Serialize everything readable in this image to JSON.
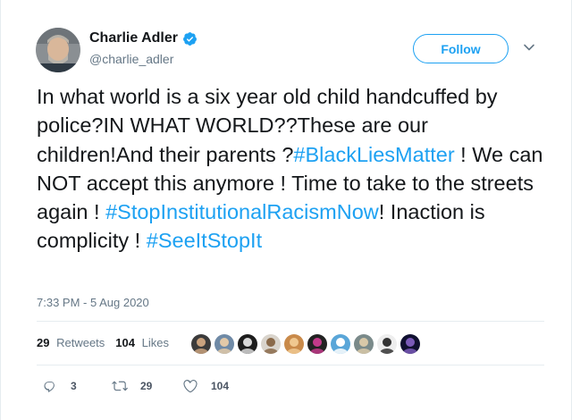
{
  "author": {
    "display_name": "Charlie Adler",
    "handle": "@charlie_adler",
    "verified": true
  },
  "follow_button": {
    "label": "Follow"
  },
  "tweet": {
    "segments": [
      {
        "text": "In what world is a six year old child handcuffed by police?IN WHAT WORLD??These are our children!And their parents ?",
        "hashtag": false
      },
      {
        "text": "#BlackLiesMatter",
        "hashtag": true
      },
      {
        "text": " ! We can NOT accept this anymore ! Time to take to the streets again ! ",
        "hashtag": false
      },
      {
        "text": "#StopInstitutionalRacismNow",
        "hashtag": true
      },
      {
        "text": "! Inaction is complicity ! ",
        "hashtag": false
      },
      {
        "text": "#SeeItStopIt",
        "hashtag": true
      }
    ],
    "timestamp": "7:33 PM - 5 Aug 2020"
  },
  "stats": {
    "retweets_count": "29",
    "retweets_label": "Retweets",
    "likes_count": "104",
    "likes_label": "Likes"
  },
  "liker_avatars": [
    {
      "bg": "#3b3b3b",
      "fg": "#c9a27e"
    },
    {
      "bg": "#6f8aa6",
      "fg": "#e2c9a8"
    },
    {
      "bg": "#1d1d1d",
      "fg": "#d8d8d8"
    },
    {
      "bg": "#d9d4cc",
      "fg": "#8a6a4a"
    },
    {
      "bg": "#c98a4a",
      "fg": "#f0c890"
    },
    {
      "bg": "#222222",
      "fg": "#c23a8a"
    },
    {
      "bg": "#5aa6d8",
      "fg": "#ffffff"
    },
    {
      "bg": "#7a8a8a",
      "fg": "#d8c8a8"
    },
    {
      "bg": "#eeeeee",
      "fg": "#333333"
    },
    {
      "bg": "#101030",
      "fg": "#7a5ab8"
    }
  ],
  "actions": {
    "replies": "3",
    "retweets": "29",
    "likes": "104"
  },
  "colors": {
    "accent": "#1da1f2",
    "text": "#14171a",
    "secondary": "#657786"
  }
}
